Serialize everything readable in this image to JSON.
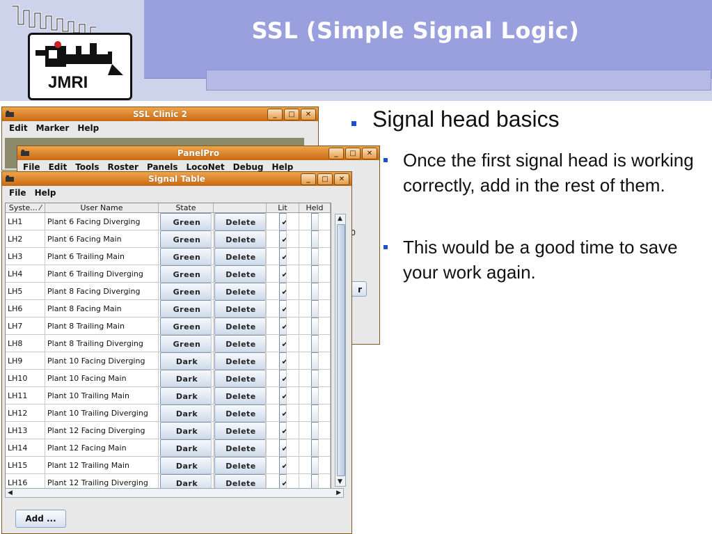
{
  "slide": {
    "title": "SSL (Simple Signal Logic)",
    "logo_text": "JMRI",
    "bullet_main": "Signal head basics",
    "sub_bullets": [
      "Once the first signal head is working correctly, add in the rest of them.",
      "This would be a good time to save your work again."
    ]
  },
  "win_clinic": {
    "title": "SSL Clinic 2",
    "menu": [
      "Edit",
      "Marker",
      "Help"
    ]
  },
  "win_panelpro": {
    "title": "PanelPro",
    "menu": [
      "File",
      "Edit",
      "Tools",
      "Roster",
      "Panels",
      "LocoNet",
      "Debug",
      "Help"
    ],
    "peek_text_1": "0",
    "peek_text_2": "r"
  },
  "win_signal": {
    "title": "Signal Table",
    "menu": [
      "File",
      "Help"
    ],
    "columns": [
      "Syste... ⁄",
      "User Name",
      "State",
      "",
      "Lit",
      "Held"
    ],
    "rows": [
      {
        "sys": "LH1",
        "name": "Plant 6 Facing Diverging",
        "state": "Green",
        "action": "Delete",
        "lit": true,
        "held": false
      },
      {
        "sys": "LH2",
        "name": "Plant 6 Facing Main",
        "state": "Green",
        "action": "Delete",
        "lit": true,
        "held": false
      },
      {
        "sys": "LH3",
        "name": "Plant 6 Trailing Main",
        "state": "Green",
        "action": "Delete",
        "lit": true,
        "held": false
      },
      {
        "sys": "LH4",
        "name": "Plant 6 Trailing Diverging",
        "state": "Green",
        "action": "Delete",
        "lit": true,
        "held": false
      },
      {
        "sys": "LH5",
        "name": "Plant 8 Facing Diverging",
        "state": "Green",
        "action": "Delete",
        "lit": true,
        "held": false
      },
      {
        "sys": "LH6",
        "name": "Plant 8 Facing Main",
        "state": "Green",
        "action": "Delete",
        "lit": true,
        "held": false
      },
      {
        "sys": "LH7",
        "name": "Plant 8 Trailing Main",
        "state": "Green",
        "action": "Delete",
        "lit": true,
        "held": false
      },
      {
        "sys": "LH8",
        "name": "Plant 8 Trailing Diverging",
        "state": "Green",
        "action": "Delete",
        "lit": true,
        "held": false
      },
      {
        "sys": "LH9",
        "name": "Plant 10 Facing Diverging",
        "state": "Dark",
        "action": "Delete",
        "lit": true,
        "held": false
      },
      {
        "sys": "LH10",
        "name": "Plant 10 Facing Main",
        "state": "Dark",
        "action": "Delete",
        "lit": true,
        "held": false
      },
      {
        "sys": "LH11",
        "name": "Plant 10 Trailing Main",
        "state": "Dark",
        "action": "Delete",
        "lit": true,
        "held": false
      },
      {
        "sys": "LH12",
        "name": "Plant 10 Trailing Diverging",
        "state": "Dark",
        "action": "Delete",
        "lit": true,
        "held": false
      },
      {
        "sys": "LH13",
        "name": "Plant 12 Facing Diverging",
        "state": "Dark",
        "action": "Delete",
        "lit": true,
        "held": false
      },
      {
        "sys": "LH14",
        "name": "Plant 12 Facing Main",
        "state": "Dark",
        "action": "Delete",
        "lit": true,
        "held": false
      },
      {
        "sys": "LH15",
        "name": "Plant 12 Trailing Main",
        "state": "Dark",
        "action": "Delete",
        "lit": true,
        "held": false
      },
      {
        "sys": "LH16",
        "name": "Plant 12 Trailing Diverging",
        "state": "Dark",
        "action": "Delete",
        "lit": true,
        "held": false
      }
    ],
    "add_button": "Add ..."
  },
  "icons": {
    "window_controls": [
      "minimize-icon",
      "maximize-icon",
      "close-icon"
    ],
    "title_icon": "locomotive-icon"
  },
  "colors": {
    "title_band": "#9aa0dd",
    "window_titlebar": "#e08a2a",
    "bullet_square": "#1c4fd0"
  }
}
